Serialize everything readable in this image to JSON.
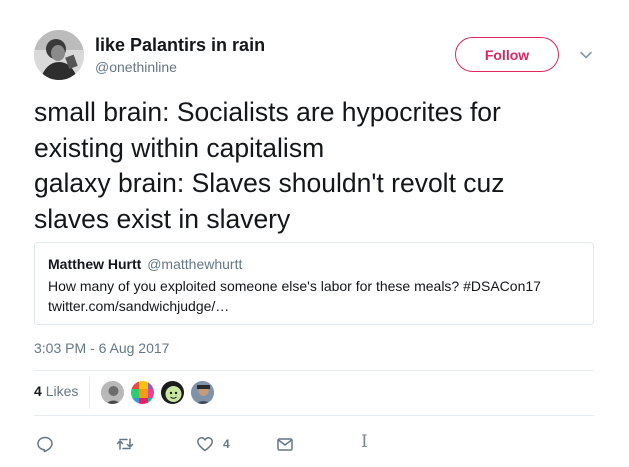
{
  "author": {
    "display_name": "like Palantirs in rain",
    "handle": "@onethinline",
    "avatar_icon": "person-photo"
  },
  "follow_button": {
    "label": "Follow",
    "color": "#e0245e"
  },
  "tweet": {
    "lines": [
      "small brain: Socialists are hypocrites for",
      "existing within capitalism",
      "galaxy brain: Slaves shouldn't revolt cuz",
      "slaves exist in slavery"
    ],
    "timestamp": "3:03 PM - 6 Aug 2017"
  },
  "quoted_tweet": {
    "name": "Matthew Hurtt",
    "handle": "@matthewhurtt",
    "text": "How many of you exploited someone else's labor for these meals? #DSACon17",
    "link": "twitter.com/sandwichjudge/…"
  },
  "stats": {
    "likes_count": "4",
    "likes_label": "Likes",
    "likers": [
      "liker-avatar-1",
      "liker-avatar-2",
      "liker-avatar-3",
      "liker-avatar-4"
    ]
  },
  "actions": {
    "reply_icon": "reply-icon",
    "retweet_icon": "retweet-icon",
    "like_icon": "heart-icon",
    "like_count": "4",
    "dm_icon": "envelope-icon"
  },
  "colors": {
    "text": "#14171a",
    "secondary": "#657786",
    "border": "#e1e8ed"
  }
}
